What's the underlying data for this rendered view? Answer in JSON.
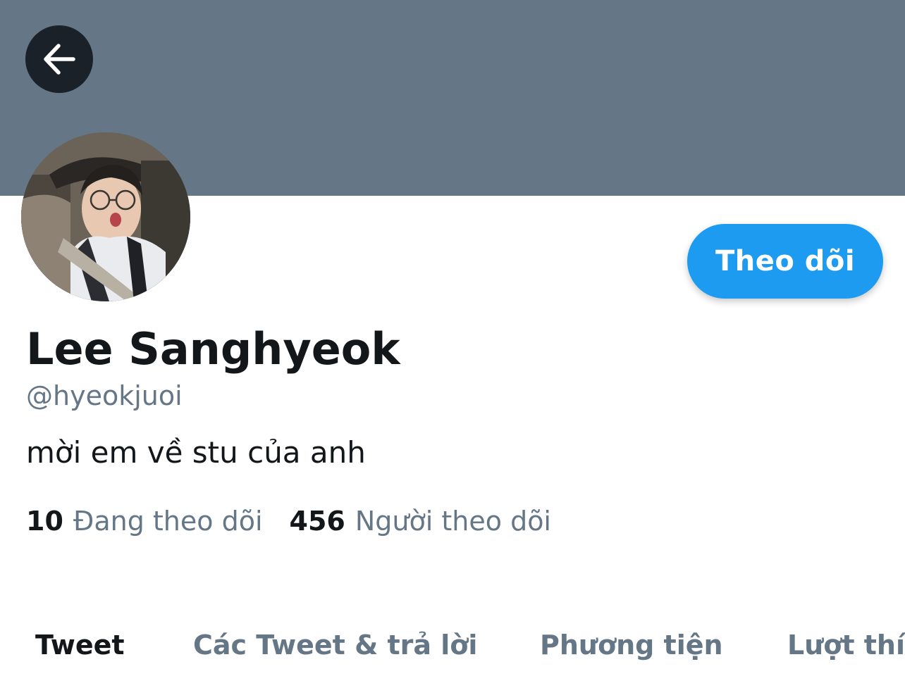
{
  "header": {
    "banner_color": "#657786",
    "back_icon": "arrow-left-icon"
  },
  "profile": {
    "name": "Lee Sanghyeok",
    "handle": "@hyeokjuoi",
    "bio": "mời em về stu của anh",
    "avatar": "profile-photo"
  },
  "actions": {
    "follow_label": "Theo dõi",
    "follow_color": "#1d9bf0"
  },
  "stats": {
    "following_count": "10",
    "following_label": "Đang theo dõi",
    "followers_count": "456",
    "followers_label": "Người theo dõi"
  },
  "tabs": [
    {
      "label": "Tweet",
      "active": true
    },
    {
      "label": "Các Tweet & trả lời",
      "active": false
    },
    {
      "label": "Phương tiện",
      "active": false
    },
    {
      "label": "Lượt thích",
      "active": false
    }
  ]
}
